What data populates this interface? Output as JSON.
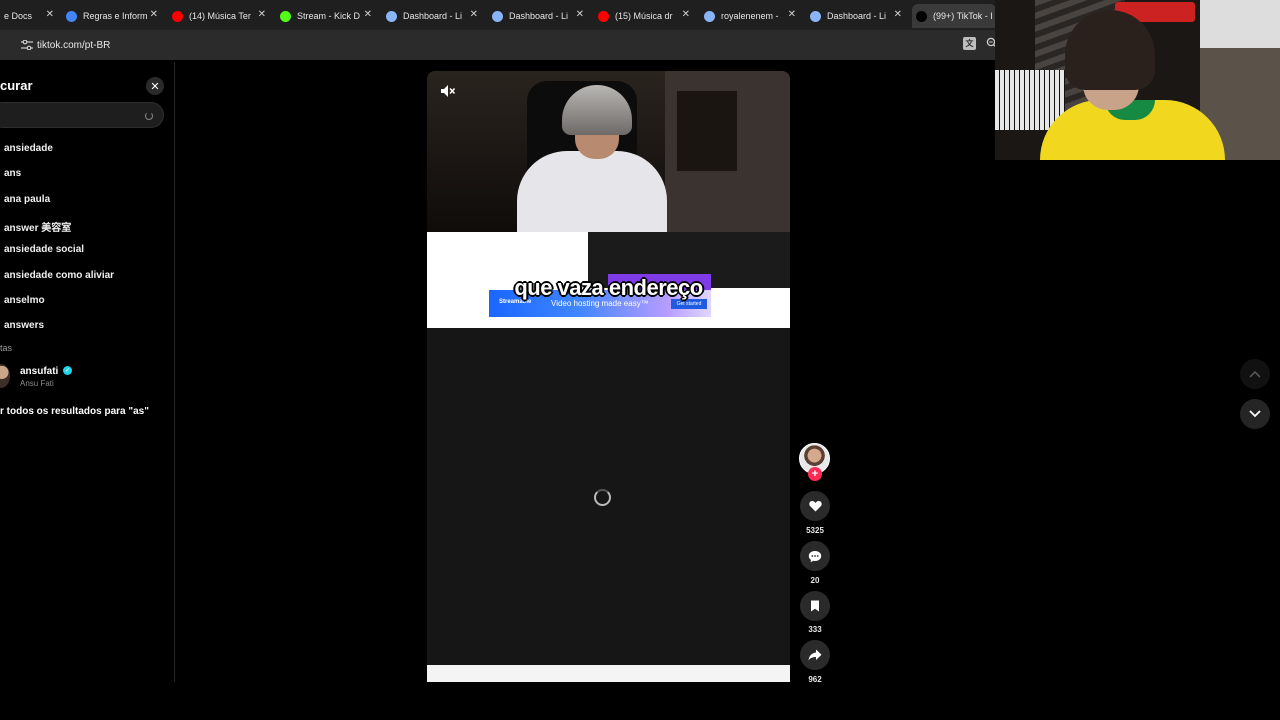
{
  "browser": {
    "tabs": [
      {
        "label": "e Docs",
        "icon": "docs-icon",
        "color": "#4285f4"
      },
      {
        "label": "Regras e Inform",
        "icon": "docs-icon",
        "color": "#4285f4"
      },
      {
        "label": "(14) Música Ter",
        "icon": "youtube-icon",
        "color": "#ff0000"
      },
      {
        "label": "Stream - Kick D",
        "icon": "kick-icon",
        "color": "#53fc18"
      },
      {
        "label": "Dashboard - Li",
        "icon": "globe-icon",
        "color": "#8ab4f8"
      },
      {
        "label": "Dashboard - Li",
        "icon": "globe-icon",
        "color": "#8ab4f8"
      },
      {
        "label": "(15) Música dr",
        "icon": "youtube-icon",
        "color": "#ff0000"
      },
      {
        "label": "royalenenem -",
        "icon": "globe-icon",
        "color": "#8ab4f8"
      },
      {
        "label": "Dashboard - Li",
        "icon": "globe-icon",
        "color": "#8ab4f8"
      },
      {
        "label": "(99+) TikTok - I",
        "icon": "tiktok-icon",
        "color": "#000000"
      }
    ],
    "url": "tiktok.com/pt-BR"
  },
  "search": {
    "title": "curar",
    "input_value": "",
    "suggestions": [
      "ansiedade",
      "ans",
      "ana paula",
      "answer 美容室",
      "ansiedade social",
      "ansiedade como aliviar",
      "anselmo",
      "answers"
    ],
    "accounts_label": "tas",
    "account": {
      "name": "ansufati",
      "subtitle": "Ansu Fati"
    },
    "see_all": "r todos os resultados para \"as\""
  },
  "video": {
    "caption": "que vaza endereço",
    "ad": {
      "brand": "Streamable",
      "tagline": "Video hosting made easy™",
      "cta": "Get started"
    },
    "bottom_text": "",
    "actions": {
      "likes": "5325",
      "comments": "20",
      "saves": "333",
      "shares": "962"
    }
  },
  "colors": {
    "accent": "#fe2c55",
    "verified": "#20d5ec"
  }
}
